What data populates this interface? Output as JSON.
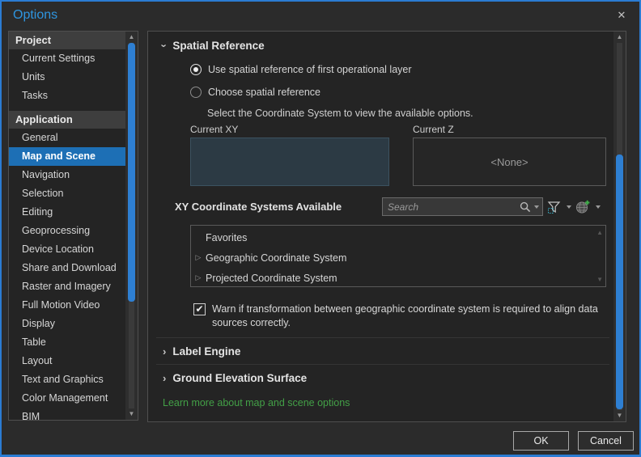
{
  "window": {
    "title": "Options",
    "close_icon": "✕"
  },
  "colors": {
    "accent_title_blue": "#2e95e0",
    "selected_item_blue": "#1d6fb5",
    "scrollbar_thumb_blue": "#2e7fd2",
    "window_border_blue": "#2b7cd3",
    "link_green": "#43a047",
    "current_xy_fill": "#2c3a44",
    "panel_background": "#242424"
  },
  "sidebar": {
    "groups": [
      {
        "label": "Project",
        "items": [
          {
            "label": "Current Settings"
          },
          {
            "label": "Units"
          },
          {
            "label": "Tasks"
          }
        ]
      },
      {
        "label": "Application",
        "items": [
          {
            "label": "General"
          },
          {
            "label": "Map and Scene"
          },
          {
            "label": "Navigation"
          },
          {
            "label": "Selection"
          },
          {
            "label": "Editing"
          },
          {
            "label": "Geoprocessing"
          },
          {
            "label": "Device Location"
          },
          {
            "label": "Share and Download"
          },
          {
            "label": "Raster and Imagery"
          },
          {
            "label": "Full Motion Video"
          },
          {
            "label": "Display"
          },
          {
            "label": "Table"
          },
          {
            "label": "Layout"
          },
          {
            "label": "Text and Graphics"
          },
          {
            "label": "Color Management"
          },
          {
            "label": "BIM"
          }
        ]
      }
    ],
    "selected_item": "Map and Scene"
  },
  "main": {
    "spatial_reference": {
      "title": "Spatial Reference",
      "radio_first_layer": "Use spatial reference of first operational layer",
      "radio_choose": "Choose spatial reference",
      "radio_selected": "Use spatial reference of first operational layer",
      "helper": "Select the Coordinate System to view the available options.",
      "current_xy_label": "Current XY",
      "current_z_label": "Current Z",
      "current_z_value": "<None>",
      "xy_available_label": "XY Coordinate Systems Available",
      "search_placeholder": "Search",
      "list_items": [
        {
          "label": "Favorites",
          "expandable": false
        },
        {
          "label": "Geographic Coordinate System",
          "expandable": true
        },
        {
          "label": "Projected Coordinate System",
          "expandable": true
        }
      ],
      "warn_checkbox_checked": true,
      "warn_check_glyph": "✔",
      "warn_text": "Warn if transformation between geographic coordinate system is required to align data sources correctly."
    },
    "collapsed_sections": [
      {
        "title": "Label Engine"
      },
      {
        "title": "Ground Elevation Surface"
      }
    ],
    "learn_more_link": "Learn more about map and scene options",
    "expander_glyph": "▷",
    "chevron_glyph": "›",
    "scroll_up_glyph": "▲",
    "scroll_down_glyph": "▼"
  },
  "footer": {
    "ok_label": "OK",
    "cancel_label": "Cancel"
  }
}
